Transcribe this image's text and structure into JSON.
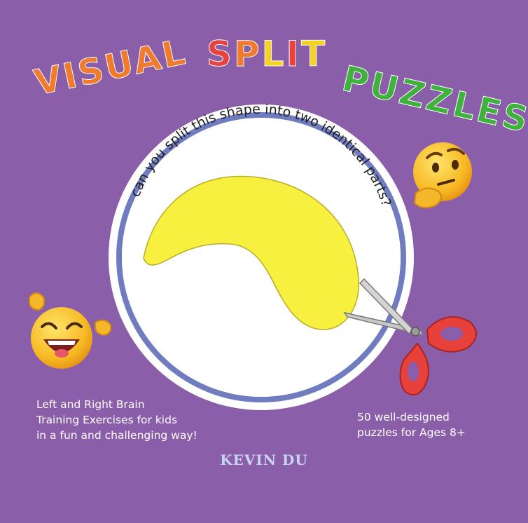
{
  "title": {
    "word1": "VISUAL",
    "word2_letters": [
      "S",
      "P",
      "L",
      "I",
      "T"
    ],
    "word3": "PUZZLES"
  },
  "colors": {
    "background": "#8a5ea8",
    "visual": "#f27a2c",
    "split": [
      "#e94040",
      "#f27a2c",
      "#f5d223",
      "#e94040",
      "#f5d223"
    ],
    "puzzles": "#3fb23d",
    "ring": "#6f7cc0",
    "shape": "#f7f03f"
  },
  "circle": {
    "question": "can you split this shape into two identical parts?"
  },
  "icons": {
    "thinking": "thinking-face-icon",
    "laughing": "laughing-face-icon",
    "scissors": "scissors-icon"
  },
  "blurb_left": {
    "line1": "Left and Right Brain",
    "line2": "Training Exercises for kids",
    "line3": "in a fun and challenging way!"
  },
  "blurb_right": {
    "line1": "50 well-designed",
    "line2": "puzzles for Ages 8+"
  },
  "author": "KEVIN DU"
}
